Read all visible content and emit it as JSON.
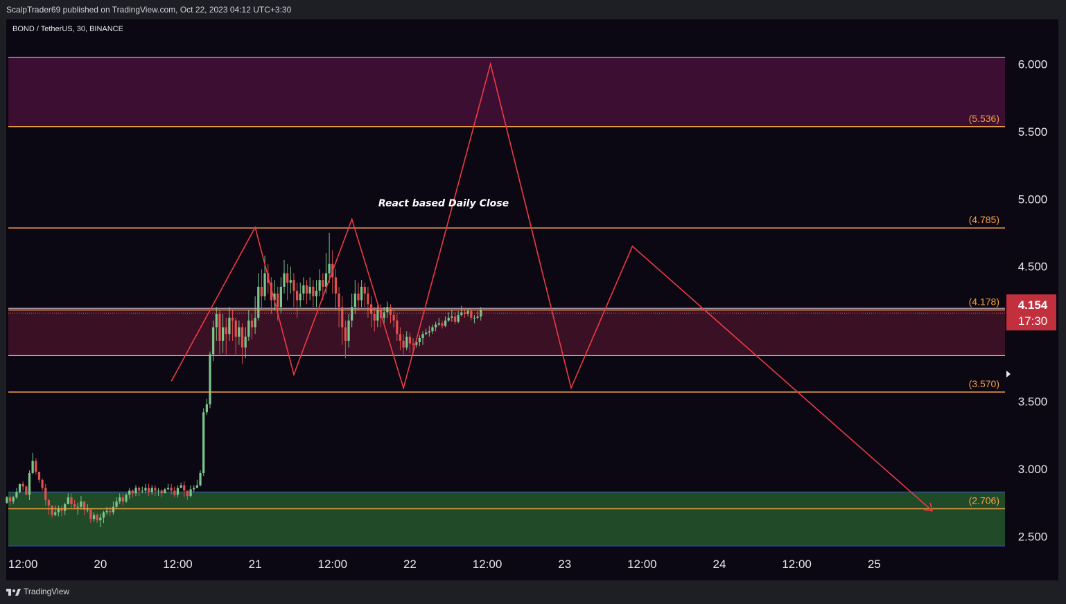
{
  "header": {
    "publisher_line": "ScalpTrader69 published on TradingView.com, Oct 22, 2023 04:12 UTC+3:30"
  },
  "footer": {
    "brand": "TradingView"
  },
  "colors": {
    "background": "#0b0713",
    "zone_purple": "#3c0e32",
    "zone_mid": "#3a1024",
    "zone_green": "#214a29",
    "level_line": "#f3a145",
    "zone_border": "#e9e0e8",
    "green_border": "#2f5cc9",
    "projection": "#ef3a43",
    "candle_up": "#7bc68a",
    "candle_down": "#e0504f",
    "price_badge": "#c2303e",
    "axis_text": "#e6e7ea"
  },
  "chart_data": {
    "type": "candlestick",
    "symbol_label": "BOND / TetherUS, 30, BINANCE",
    "ylim": [
      2.38,
      6.33
    ],
    "y_ticks": [
      6.0,
      5.5,
      5.0,
      4.5,
      3.5,
      3.0,
      2.5
    ],
    "y_tick_labels": [
      "6.000",
      "5.500",
      "5.000",
      "4.500",
      "3.500",
      "3.000",
      "2.500"
    ],
    "xlim_hours": [
      -14.6,
      140.5
    ],
    "x_tick_labels": [
      {
        "hour": -12,
        "label": "12:00"
      },
      {
        "hour": 0,
        "label": "20"
      },
      {
        "hour": 12,
        "label": "12:00"
      },
      {
        "hour": 24,
        "label": "21"
      },
      {
        "hour": 36,
        "label": "12:00"
      },
      {
        "hour": 48,
        "label": "22"
      },
      {
        "hour": 60,
        "label": "12:00"
      },
      {
        "hour": 72,
        "label": "23"
      },
      {
        "hour": 84,
        "label": "12:00"
      },
      {
        "hour": 96,
        "label": "24"
      },
      {
        "hour": 108,
        "label": "12:00"
      },
      {
        "hour": 120,
        "label": "25"
      }
    ],
    "current_price": {
      "value": 4.154,
      "label": "4.154",
      "countdown": "17:30"
    },
    "zones": [
      {
        "name": "upper-supply",
        "y_from": 5.536,
        "y_to": 6.05
      },
      {
        "name": "mid-range",
        "y_from": 3.84,
        "y_to": 4.19
      },
      {
        "name": "demand",
        "y_from": 2.43,
        "y_to": 2.83
      }
    ],
    "levels": [
      {
        "value": 5.536,
        "label": "(5.536)"
      },
      {
        "value": 4.785,
        "label": "(4.785)"
      },
      {
        "value": 4.178,
        "label": "(4.178)"
      },
      {
        "value": 3.57,
        "label": "(3.570)"
      },
      {
        "value": 2.706,
        "label": "(2.706)"
      }
    ],
    "annotation": {
      "text": "React based Daily Close",
      "hour": 36,
      "y": 4.95
    },
    "projection_path": [
      [
        11.0,
        3.65
      ],
      [
        24.0,
        4.79
      ],
      [
        30.0,
        3.7
      ],
      [
        39.0,
        4.85
      ],
      [
        47.0,
        3.6
      ],
      [
        60.5,
        6.0
      ],
      [
        73.0,
        3.6
      ],
      [
        82.5,
        4.65
      ],
      [
        129.0,
        2.69
      ]
    ],
    "candles": [
      [
        -14.5,
        2.75,
        2.79,
        2.74,
        2.8
      ],
      [
        -14.0,
        2.79,
        2.76,
        2.73,
        2.8
      ],
      [
        -13.5,
        2.76,
        2.79,
        2.74,
        2.8
      ],
      [
        -13.0,
        2.79,
        2.83,
        2.78,
        2.86
      ],
      [
        -12.5,
        2.83,
        2.89,
        2.82,
        2.89
      ],
      [
        -12.0,
        2.89,
        2.87,
        2.84,
        2.91
      ],
      [
        -11.5,
        2.87,
        2.81,
        2.81,
        2.88
      ],
      [
        -11.0,
        2.81,
        2.97,
        2.77,
        2.99
      ],
      [
        -10.5,
        2.97,
        3.06,
        2.96,
        3.12
      ],
      [
        -10.0,
        3.06,
        2.98,
        2.96,
        3.08
      ],
      [
        -9.5,
        2.98,
        2.92,
        2.9,
        2.98
      ],
      [
        -9.0,
        2.92,
        2.86,
        2.84,
        2.93
      ],
      [
        -8.5,
        2.86,
        2.77,
        2.73,
        2.89
      ],
      [
        -8.0,
        2.77,
        2.73,
        2.66,
        2.78
      ],
      [
        -7.5,
        2.73,
        2.66,
        2.64,
        2.73
      ],
      [
        -7.0,
        2.66,
        2.68,
        2.65,
        2.73
      ],
      [
        -6.5,
        2.68,
        2.71,
        2.65,
        2.73
      ],
      [
        -6.0,
        2.71,
        2.69,
        2.65,
        2.73
      ],
      [
        -5.5,
        2.69,
        2.74,
        2.66,
        2.75
      ],
      [
        -5.0,
        2.74,
        2.79,
        2.74,
        2.82
      ],
      [
        -4.5,
        2.79,
        2.74,
        2.71,
        2.82
      ],
      [
        -4.0,
        2.74,
        2.72,
        2.71,
        2.77
      ],
      [
        -3.5,
        2.72,
        2.72,
        2.66,
        2.75
      ],
      [
        -3.0,
        2.72,
        2.76,
        2.7,
        2.8
      ],
      [
        -2.5,
        2.76,
        2.7,
        2.66,
        2.76
      ],
      [
        -2.0,
        2.7,
        2.7,
        2.68,
        2.74
      ],
      [
        -1.5,
        2.7,
        2.63,
        2.6,
        2.7
      ],
      [
        -1.0,
        2.63,
        2.66,
        2.61,
        2.68
      ],
      [
        -0.5,
        2.66,
        2.62,
        2.6,
        2.67
      ],
      [
        0.0,
        2.62,
        2.64,
        2.57,
        2.67
      ],
      [
        0.5,
        2.64,
        2.68,
        2.6,
        2.69
      ],
      [
        1.0,
        2.68,
        2.69,
        2.66,
        2.72
      ],
      [
        1.5,
        2.69,
        2.68,
        2.65,
        2.72
      ],
      [
        2.0,
        2.68,
        2.72,
        2.66,
        2.76
      ],
      [
        2.5,
        2.72,
        2.76,
        2.71,
        2.79
      ],
      [
        3.0,
        2.76,
        2.79,
        2.74,
        2.82
      ],
      [
        3.5,
        2.79,
        2.76,
        2.73,
        2.82
      ],
      [
        4.0,
        2.76,
        2.81,
        2.75,
        2.82
      ],
      [
        4.5,
        2.81,
        2.84,
        2.78,
        2.86
      ],
      [
        5.0,
        2.84,
        2.82,
        2.79,
        2.85
      ],
      [
        5.5,
        2.82,
        2.86,
        2.8,
        2.88
      ],
      [
        6.0,
        2.86,
        2.84,
        2.8,
        2.87
      ],
      [
        6.5,
        2.84,
        2.84,
        2.82,
        2.87
      ],
      [
        7.0,
        2.84,
        2.86,
        2.82,
        2.89
      ],
      [
        7.5,
        2.86,
        2.83,
        2.8,
        2.89
      ],
      [
        8.0,
        2.83,
        2.86,
        2.81,
        2.88
      ],
      [
        8.5,
        2.86,
        2.84,
        2.8,
        2.88
      ],
      [
        9.0,
        2.84,
        2.84,
        2.8,
        2.86
      ],
      [
        9.5,
        2.84,
        2.82,
        2.79,
        2.85
      ],
      [
        10.0,
        2.82,
        2.85,
        2.82,
        2.86
      ],
      [
        10.5,
        2.85,
        2.86,
        2.84,
        2.89
      ],
      [
        11.0,
        2.86,
        2.84,
        2.81,
        2.89
      ],
      [
        11.5,
        2.84,
        2.81,
        2.79,
        2.87
      ],
      [
        12.0,
        2.81,
        2.86,
        2.79,
        2.88
      ],
      [
        12.5,
        2.86,
        2.88,
        2.86,
        2.9
      ],
      [
        13.0,
        2.88,
        2.84,
        2.79,
        2.91
      ],
      [
        13.5,
        2.84,
        2.8,
        2.77,
        2.84
      ],
      [
        14.0,
        2.8,
        2.85,
        2.79,
        2.88
      ],
      [
        14.5,
        2.85,
        2.86,
        2.83,
        2.88
      ],
      [
        15.0,
        2.86,
        2.88,
        2.87,
        2.92
      ],
      [
        15.5,
        2.88,
        2.97,
        2.87,
        2.99
      ],
      [
        16.0,
        2.97,
        3.42,
        2.95,
        3.45
      ],
      [
        16.5,
        3.42,
        3.48,
        3.4,
        3.52
      ],
      [
        17.0,
        3.48,
        3.85,
        3.45,
        3.87
      ],
      [
        17.5,
        3.85,
        4.05,
        3.8,
        4.1
      ],
      [
        18.0,
        4.05,
        4.15,
        3.95,
        4.2
      ],
      [
        18.5,
        4.15,
        3.95,
        3.85,
        4.18
      ],
      [
        19.0,
        3.95,
        4.05,
        3.86,
        4.15
      ],
      [
        19.5,
        4.05,
        4.0,
        3.85,
        4.12
      ],
      [
        20.0,
        4.0,
        4.12,
        3.95,
        4.2
      ],
      [
        20.5,
        4.12,
        4.1,
        3.95,
        4.18
      ],
      [
        21.0,
        4.1,
        3.98,
        3.85,
        4.12
      ],
      [
        21.5,
        3.98,
        4.05,
        3.92,
        4.1
      ],
      [
        22.0,
        4.05,
        3.9,
        3.78,
        4.08
      ],
      [
        22.5,
        3.9,
        3.98,
        3.82,
        4.05
      ],
      [
        23.0,
        3.98,
        4.1,
        3.95,
        4.18
      ],
      [
        23.5,
        4.1,
        4.05,
        3.96,
        4.15
      ],
      [
        24.0,
        4.05,
        4.12,
        4.0,
        4.28
      ],
      [
        24.5,
        4.12,
        4.35,
        4.1,
        4.45
      ],
      [
        25.0,
        4.35,
        4.28,
        4.18,
        4.48
      ],
      [
        25.5,
        4.28,
        4.45,
        4.25,
        4.58
      ],
      [
        26.0,
        4.45,
        4.38,
        4.3,
        4.52
      ],
      [
        26.5,
        4.38,
        4.25,
        4.15,
        4.42
      ],
      [
        27.0,
        4.25,
        4.3,
        4.18,
        4.4
      ],
      [
        27.5,
        4.3,
        4.2,
        4.1,
        4.35
      ],
      [
        28.0,
        4.2,
        4.35,
        4.15,
        4.42
      ],
      [
        28.5,
        4.35,
        4.45,
        4.3,
        4.55
      ],
      [
        29.0,
        4.45,
        4.38,
        4.25,
        4.52
      ],
      [
        29.5,
        4.38,
        4.4,
        4.3,
        4.5
      ],
      [
        30.0,
        4.4,
        4.32,
        4.2,
        4.45
      ],
      [
        30.5,
        4.32,
        4.25,
        4.12,
        4.38
      ],
      [
        31.0,
        4.25,
        4.3,
        4.2,
        4.38
      ],
      [
        31.5,
        4.3,
        4.36,
        4.25,
        4.42
      ],
      [
        32.0,
        4.36,
        4.3,
        4.22,
        4.4
      ],
      [
        32.5,
        4.3,
        4.35,
        4.25,
        4.42
      ],
      [
        33.0,
        4.35,
        4.28,
        4.2,
        4.4
      ],
      [
        33.5,
        4.28,
        4.32,
        4.2,
        4.4
      ],
      [
        34.0,
        4.32,
        4.4,
        4.28,
        4.48
      ],
      [
        34.5,
        4.4,
        4.35,
        4.25,
        4.45
      ],
      [
        35.0,
        4.35,
        4.45,
        4.3,
        4.6
      ],
      [
        35.5,
        4.45,
        4.52,
        4.38,
        4.75
      ],
      [
        36.0,
        4.52,
        4.42,
        4.3,
        4.62
      ],
      [
        36.5,
        4.42,
        4.3,
        4.18,
        4.48
      ],
      [
        37.0,
        4.3,
        4.2,
        4.05,
        4.35
      ],
      [
        37.5,
        4.2,
        4.05,
        3.92,
        4.28
      ],
      [
        38.0,
        4.05,
        3.95,
        3.82,
        4.1
      ],
      [
        38.5,
        3.95,
        4.1,
        3.9,
        4.15
      ],
      [
        39.0,
        4.1,
        4.2,
        4.05,
        4.3
      ],
      [
        39.5,
        4.2,
        4.3,
        4.15,
        4.4
      ],
      [
        40.0,
        4.3,
        4.25,
        4.18,
        4.38
      ],
      [
        40.5,
        4.25,
        4.35,
        4.2,
        4.4
      ],
      [
        41.0,
        4.35,
        4.3,
        4.2,
        4.38
      ],
      [
        41.5,
        4.3,
        4.22,
        4.12,
        4.35
      ],
      [
        42.0,
        4.22,
        4.15,
        4.05,
        4.28
      ],
      [
        42.5,
        4.15,
        4.1,
        4.02,
        4.2
      ],
      [
        43.0,
        4.1,
        4.18,
        4.05,
        4.22
      ],
      [
        43.5,
        4.18,
        4.12,
        4.05,
        4.22
      ],
      [
        44.0,
        4.12,
        4.16,
        4.08,
        4.2
      ],
      [
        44.5,
        4.16,
        4.2,
        4.12,
        4.24
      ],
      [
        45.0,
        4.2,
        4.14,
        4.08,
        4.22
      ],
      [
        45.5,
        4.14,
        4.1,
        4.05,
        4.18
      ],
      [
        46.0,
        4.1,
        4.0,
        3.95,
        4.15
      ],
      [
        46.5,
        4.0,
        3.95,
        3.88,
        4.05
      ],
      [
        47.0,
        3.95,
        3.9,
        3.85,
        4.0
      ],
      [
        47.5,
        3.9,
        3.98,
        3.88,
        4.02
      ],
      [
        48.0,
        3.98,
        3.93,
        3.86,
        4.01
      ],
      [
        48.5,
        3.93,
        3.92,
        3.85,
        3.97
      ],
      [
        49.0,
        3.92,
        3.94,
        3.9,
        3.97
      ],
      [
        49.5,
        3.94,
        3.97,
        3.91,
        3.99
      ],
      [
        50.0,
        3.97,
        4.0,
        3.92,
        4.02
      ],
      [
        50.5,
        4.0,
        4.01,
        3.99,
        4.04
      ],
      [
        51.0,
        4.01,
        4.02,
        3.98,
        4.06
      ],
      [
        51.5,
        4.02,
        4.05,
        4.0,
        4.07
      ],
      [
        52.0,
        4.05,
        4.07,
        4.02,
        4.09
      ],
      [
        52.5,
        4.07,
        4.08,
        4.06,
        4.12
      ],
      [
        53.0,
        4.08,
        4.06,
        4.04,
        4.1
      ],
      [
        53.5,
        4.06,
        4.1,
        4.05,
        4.13
      ],
      [
        54.0,
        4.1,
        4.12,
        4.09,
        4.16
      ],
      [
        54.5,
        4.12,
        4.13,
        4.09,
        4.18
      ],
      [
        55.0,
        4.13,
        4.09,
        4.07,
        4.16
      ],
      [
        55.5,
        4.09,
        4.14,
        4.08,
        4.17
      ],
      [
        56.0,
        4.14,
        4.16,
        4.13,
        4.21
      ],
      [
        56.5,
        4.16,
        4.15,
        4.12,
        4.19
      ],
      [
        57.0,
        4.15,
        4.17,
        4.13,
        4.19
      ],
      [
        57.5,
        4.17,
        4.12,
        4.1,
        4.19
      ],
      [
        58.0,
        4.12,
        4.12,
        4.08,
        4.14
      ],
      [
        58.5,
        4.12,
        4.13,
        4.11,
        4.17
      ],
      [
        59.0,
        4.13,
        4.18,
        4.1,
        4.2
      ]
    ]
  }
}
